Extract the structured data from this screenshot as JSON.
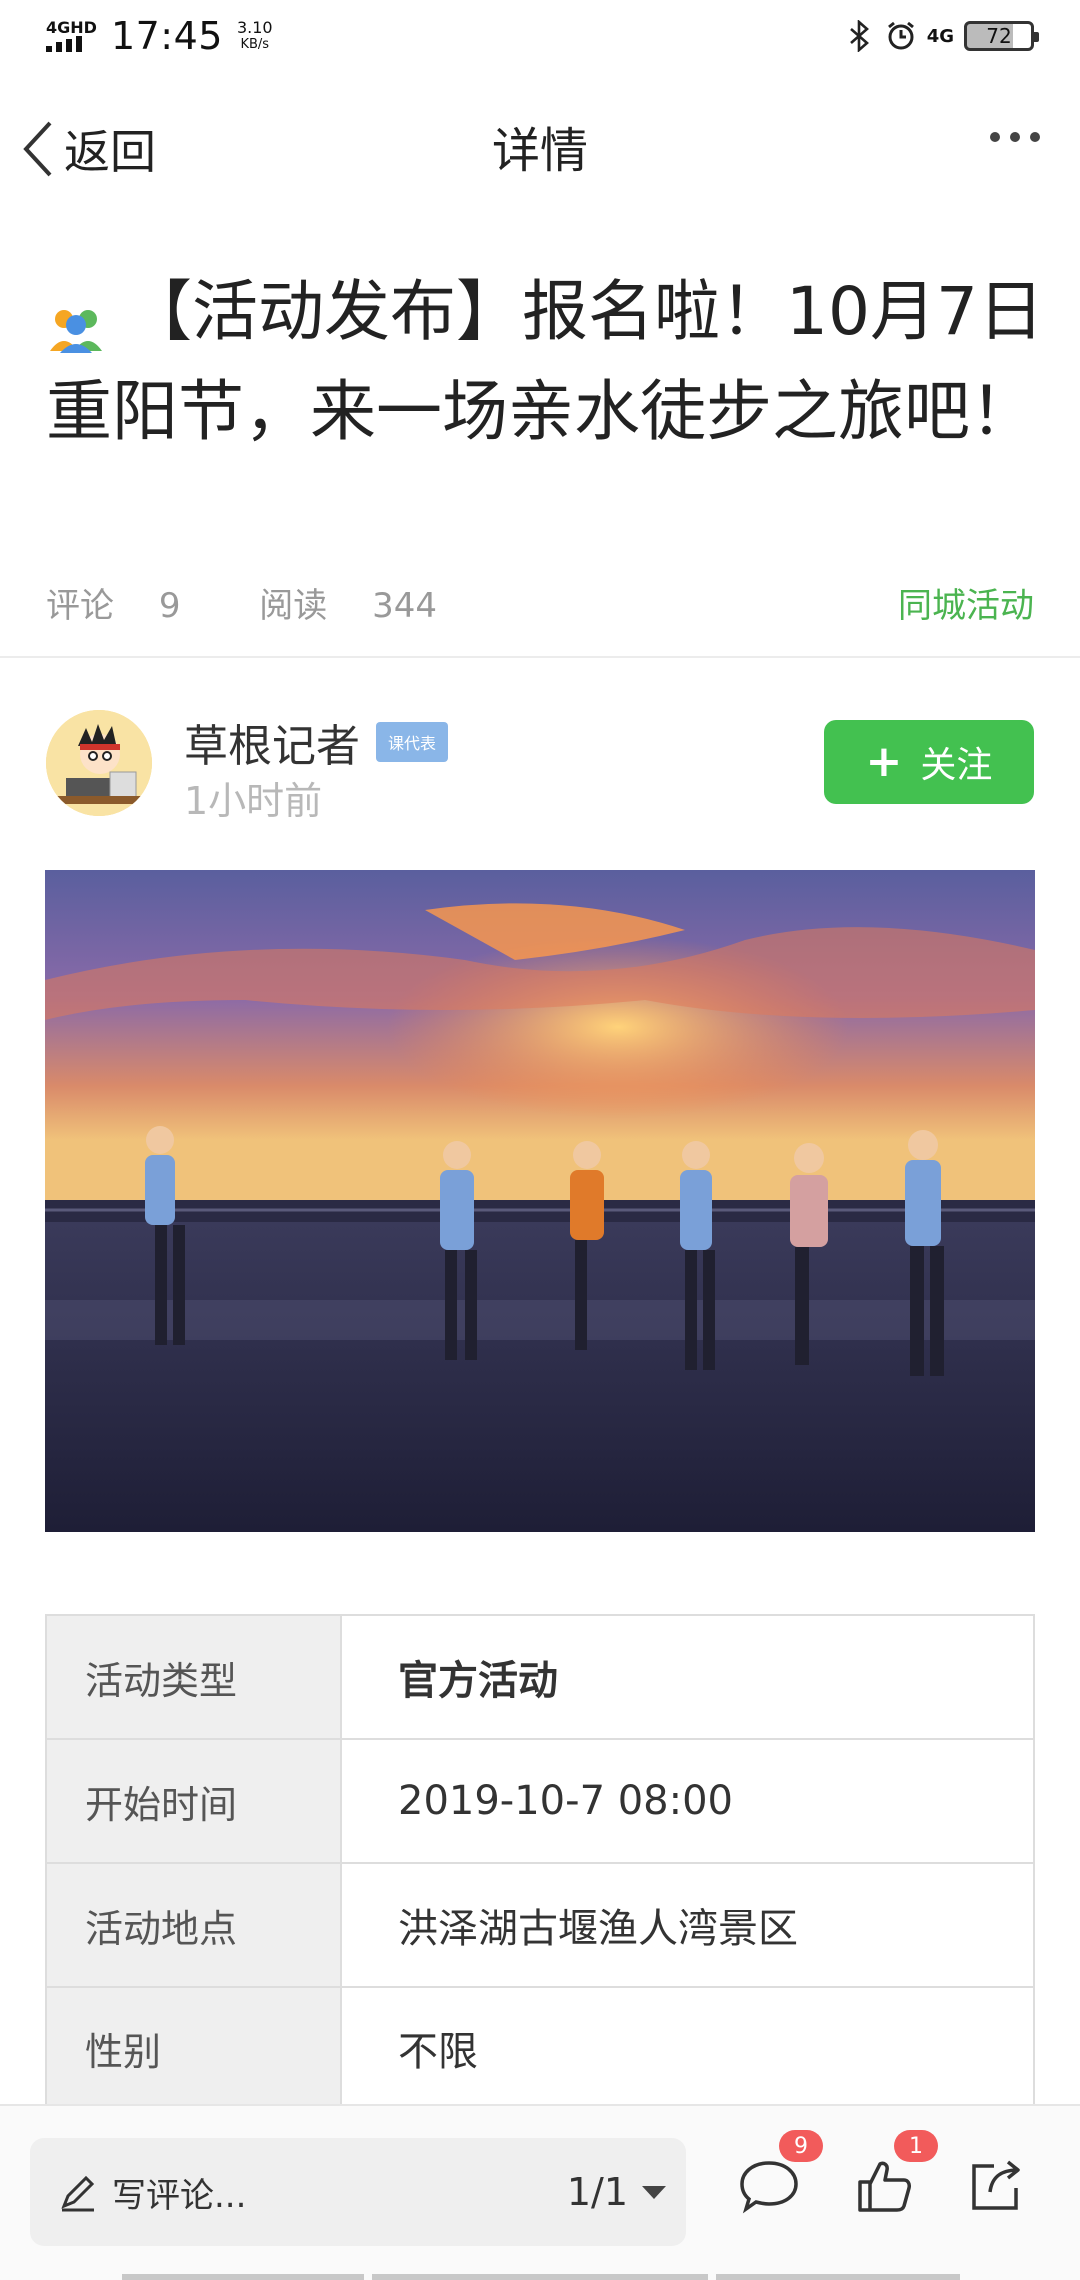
{
  "status_bar": {
    "network": "4GHD",
    "time": "17:45",
    "speed_value": "3.10",
    "speed_unit": "KB/s",
    "mobile": "4G",
    "battery": "72",
    "icons": [
      "signal-icon",
      "bluetooth-icon",
      "alarm-icon",
      "battery-icon"
    ]
  },
  "nav": {
    "back_label": "返回",
    "title": "详情"
  },
  "article": {
    "title": "【活动发布】报名啦！10月7日重阳节，来一场亲水徒步之旅吧！",
    "comments_label": "评论",
    "comments_count": "9",
    "reads_label": "阅读",
    "reads_count": "344",
    "category": "同城活动"
  },
  "author": {
    "name": "草根记者",
    "badge": "课代表",
    "time": "1小时前",
    "follow_label": "关注"
  },
  "activity": {
    "rows": [
      {
        "label": "活动类型",
        "value": "官方活动"
      },
      {
        "label": "开始时间",
        "value": "2019-10-7 08:00"
      },
      {
        "label": "活动地点",
        "value": "洪泽湖古堰渔人湾景区"
      },
      {
        "label": "性别",
        "value": "不限"
      }
    ]
  },
  "bottom_bar": {
    "comment_placeholder": "写评论...",
    "page": "1/1",
    "comment_count": "9",
    "like_count": "1"
  },
  "colors": {
    "accent_green": "#43c150",
    "category_green": "#4bb450",
    "badge_blue": "#8ab6e8",
    "notification_red": "#f25b5b"
  }
}
